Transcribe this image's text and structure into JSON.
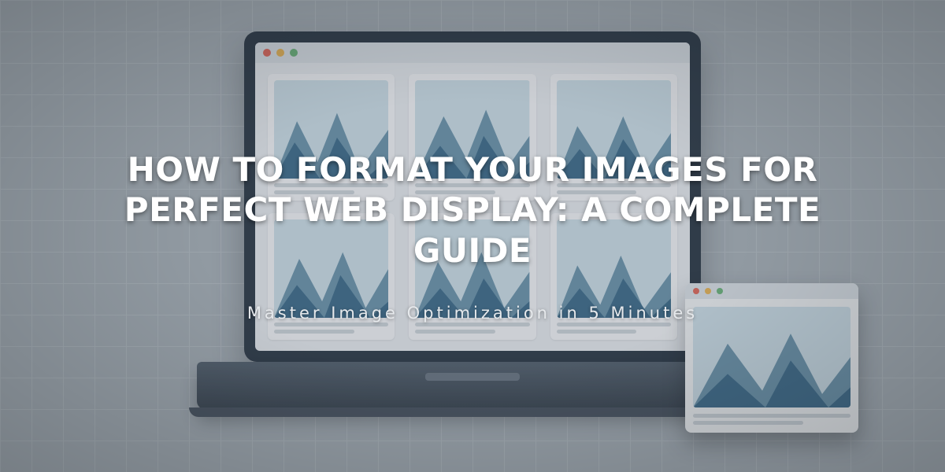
{
  "hero": {
    "title": "HOW TO FORMAT YOUR IMAGES FOR PERFECT WEB DISPLAY: A COMPLETE GUIDE",
    "subtitle": "Master Image Optimization in 5 Minutes"
  },
  "colors": {
    "sky": "#cfe0ea",
    "mountain_back": "#6e97ae",
    "mountain_front": "#3f6e8c",
    "snow": "#eef5f8"
  }
}
